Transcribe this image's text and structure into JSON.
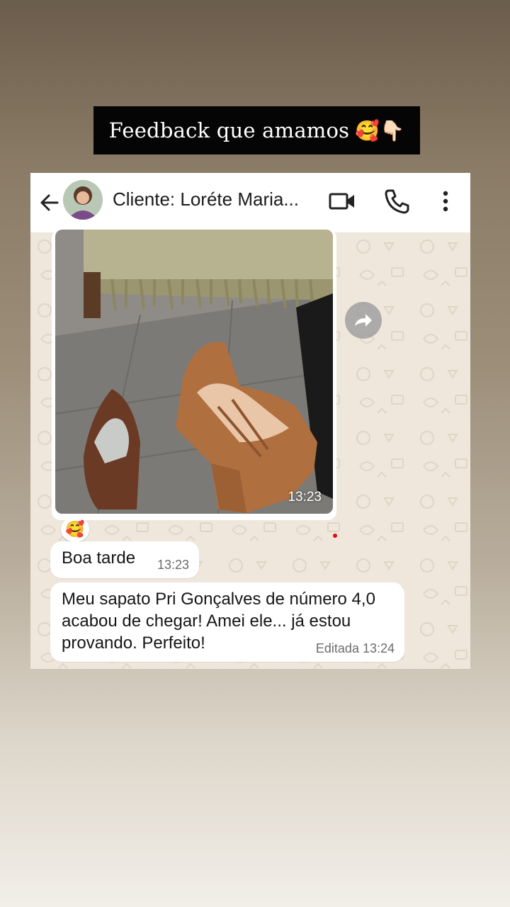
{
  "banner": {
    "text": "Feedback que amamos",
    "emoji": "🥰👇🏻"
  },
  "chat": {
    "header": {
      "contact_name": "Cliente: Loréte Maria...",
      "icons": [
        "back-arrow-icon",
        "video-call-icon",
        "phone-call-icon",
        "more-vert-icon"
      ]
    },
    "photo_message": {
      "time": "13:23"
    },
    "reaction": {
      "emoji": "🥰"
    },
    "messages": [
      {
        "text": "Boa tarde",
        "meta": "13:23"
      },
      {
        "text": "Meu sapato Pri Gonçalves de número 4,0 acabou de chegar! Amei ele... já estou provando. Perfeito!",
        "meta": "Editada 13:24"
      }
    ]
  },
  "colors": {
    "header_bg": "#ffffff",
    "chat_bg": "#efe7dc",
    "bubble": "#ffffff",
    "banner_bg": "#050505"
  }
}
